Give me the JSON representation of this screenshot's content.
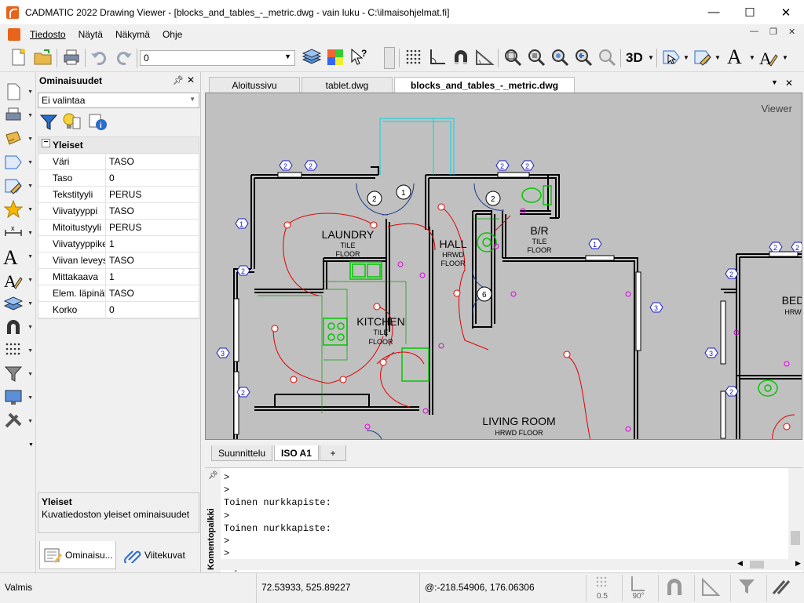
{
  "window": {
    "title": "CADMATIC 2022 Drawing Viewer - [blocks_and_tables_-_metric.dwg - vain luku - C:\\ilmaisohjelmat.fi]",
    "minimize": "—",
    "maximize": "☐",
    "close": "✕"
  },
  "menu": {
    "items": [
      "Tiedosto",
      "Näytä",
      "Näkymä",
      "Ohje"
    ]
  },
  "toolbar": {
    "layer_value": "0",
    "view3d_label": "3D"
  },
  "properties": {
    "title": "Ominaisuudet",
    "selection": "Ei valintaa",
    "group": "Yleiset",
    "rows": [
      {
        "key": "Väri",
        "value": "TASO"
      },
      {
        "key": "Taso",
        "value": "0"
      },
      {
        "key": "Tekstityyli",
        "value": "PERUS"
      },
      {
        "key": "Viivatyyppi",
        "value": "TASO"
      },
      {
        "key": "Mitoitustyyli",
        "value": "PERUS"
      },
      {
        "key": "Viivatyyppikerroin",
        "value": "1"
      },
      {
        "key": "Viivan leveys",
        "value": "TASO"
      },
      {
        "key": "Mittakaava",
        "value": "1"
      },
      {
        "key": "Elem. läpinäkyvyys",
        "value": "TASO"
      },
      {
        "key": "Korko",
        "value": "0"
      }
    ],
    "desc_title": "Yleiset",
    "desc_text": "Kuvatiedoston yleiset ominaisuudet",
    "tabs": [
      "Ominaisu...",
      "Viitekuvat"
    ]
  },
  "doc_tabs": [
    "Aloitussivu",
    "tablet.dwg",
    "blocks_and_tables_-_metric.dwg"
  ],
  "viewer": {
    "label": "Viewer",
    "rooms": [
      {
        "name": "LAUNDRY",
        "line1": "TILE",
        "line2": "FLOOR"
      },
      {
        "name": "HALL",
        "line1": "HRWD",
        "line2": "FLOOR"
      },
      {
        "name": "B/R",
        "line1": "TILE",
        "line2": "FLOOR"
      },
      {
        "name": "KITCHEN",
        "line1": "TILE",
        "line2": "FLOOR"
      },
      {
        "name": "LIVING ROOM",
        "line1": "HRWD FLOOR",
        "line2": ""
      },
      {
        "name": "BED",
        "line1": "HRW",
        "line2": ""
      }
    ]
  },
  "layout_tabs": [
    "Suunnittelu",
    "ISO A1",
    "+"
  ],
  "command": {
    "side_label": "Komentopalkki",
    "lines": [
      ">",
      ">",
      "Toinen nurkkapiste:",
      ">",
      "Toinen nurkkapiste:",
      ">",
      ">",
      ">"
    ]
  },
  "status": {
    "ready": "Valmis",
    "coord": "72.53933, 525.89227",
    "rel_coord": "@:-218.54906, 176.06306",
    "grid_value": "0.5",
    "angle_value": "90°"
  }
}
